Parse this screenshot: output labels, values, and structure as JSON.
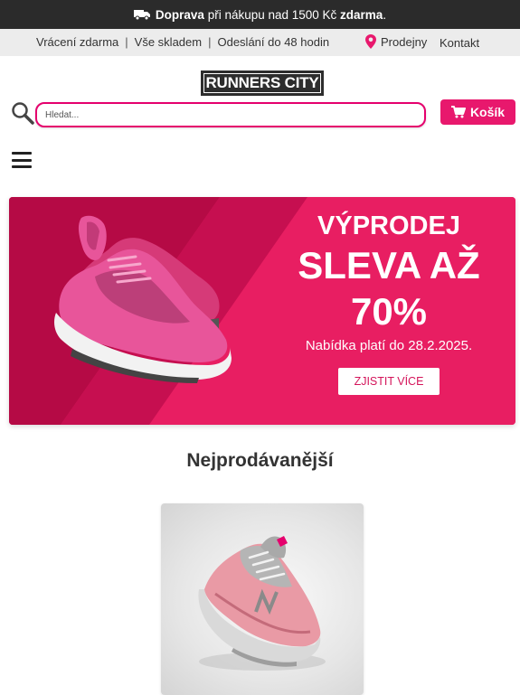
{
  "topbar": {
    "shipping_bold": "Doprava",
    "shipping_mid": " při nákupu nad 1500 Kč ",
    "shipping_free": "zdarma",
    "shipping_end": "."
  },
  "infobar": {
    "returns": "Vrácení zdarma",
    "stock": "Vše skladem",
    "dispatch": "Odeslání do 48 hodin",
    "sep": "|",
    "stores": "Prodejny",
    "contact": "Kontakt"
  },
  "header": {
    "logo_text": "RUNNERS CITY",
    "search_placeholder": "Hledat...",
    "cart_label": "Košík"
  },
  "banner": {
    "line1": "VÝPRODEJ",
    "line2": "SLEVA AŽ",
    "line3": "70%",
    "validity": "Nabídka platí do 28.2.2025.",
    "cta": "ZJISTIT VÍCE"
  },
  "bestsellers": {
    "title": "Nejprodávanější"
  },
  "colors": {
    "brand_pink": "#e8186d",
    "banner_dark": "#b50a45",
    "topbar_bg": "#2b2b2b"
  },
  "icons": {
    "truck": "truck-icon",
    "pin": "map-pin-icon",
    "search": "search-icon",
    "cart": "cart-icon",
    "menu": "hamburger-menu-icon"
  }
}
